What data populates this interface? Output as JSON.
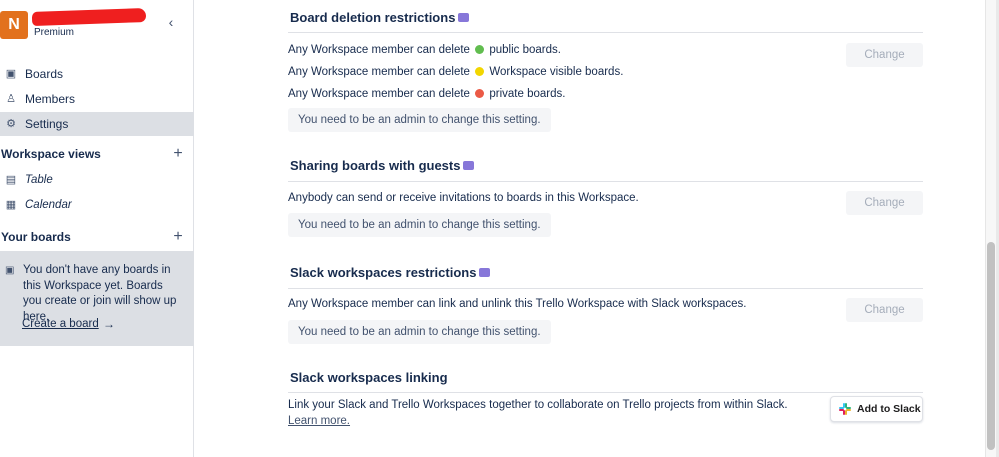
{
  "workspace": {
    "initial": "N",
    "plan": "Premium",
    "collapse_label": "‹"
  },
  "sidebar": {
    "nav": [
      {
        "label": "Boards",
        "icon": "board-icon"
      },
      {
        "label": "Members",
        "icon": "person-icon"
      },
      {
        "label": "Settings",
        "icon": "gear-icon",
        "active": true
      }
    ],
    "views_heading": "Workspace views",
    "views": [
      {
        "label": "Table",
        "icon": "table-icon"
      },
      {
        "label": "Calendar",
        "icon": "calendar-icon"
      }
    ],
    "boards_heading": "Your boards",
    "empty_message": "You don't have any boards in this Workspace yet. Boards you create or join will show up here.",
    "create_board": "Create a board",
    "create_arrow": "→",
    "plus": "+"
  },
  "main": {
    "board_deletion": {
      "title": "Board deletion restrictions",
      "rows": [
        {
          "prefix": "Any Workspace member can delete",
          "suffix": "public boards.",
          "color": "#61bd4f"
        },
        {
          "prefix": "Any Workspace member can delete",
          "suffix": "Workspace visible boards.",
          "color": "#f2d600"
        },
        {
          "prefix": "Any Workspace member can delete",
          "suffix": "private boards.",
          "color": "#eb5a46"
        }
      ],
      "note": "You need to be an admin to change this setting.",
      "button": "Change"
    },
    "sharing": {
      "title": "Sharing boards with guests",
      "text": "Anybody can send or receive invitations to boards in this Workspace.",
      "note": "You need to be an admin to change this setting.",
      "button": "Change"
    },
    "slack_restrictions": {
      "title": "Slack workspaces restrictions",
      "text": "Any Workspace member can link and unlink this Trello Workspace with Slack workspaces.",
      "note": "You need to be an admin to change this setting.",
      "button": "Change"
    },
    "slack_linking": {
      "title": "Slack workspaces linking",
      "text": "Link your Slack and Trello Workspaces together to collaborate on Trello projects from within Slack.",
      "learn_more": "Learn more.",
      "button": "Add to Slack"
    }
  },
  "colors": {
    "premium_badge": "#8777d9",
    "workspace_logo": "#e2711d",
    "active_nav": "#dcdfe4"
  }
}
